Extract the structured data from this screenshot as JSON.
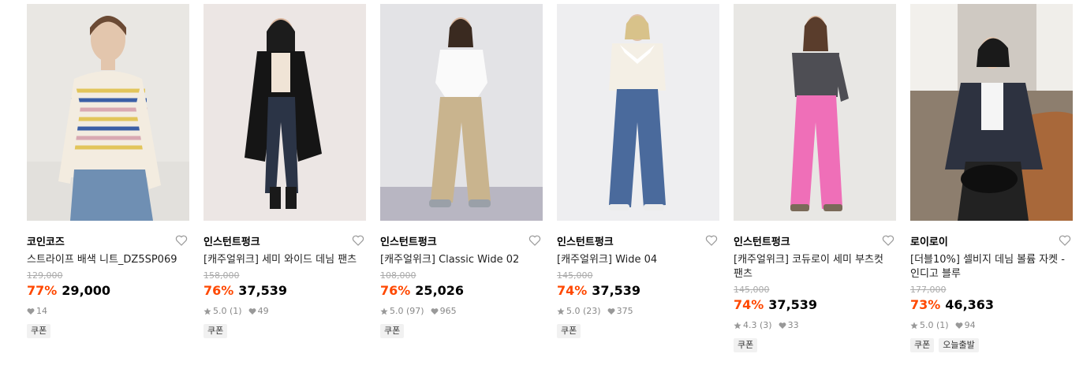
{
  "products": [
    {
      "brand": "코인코즈",
      "title": "스트라이프 배색 니트_DZ5SP069",
      "original_price": "129,000",
      "discount": "77%",
      "price": "29,000",
      "rating": "",
      "reviews": "",
      "likes": "14",
      "tags": [
        "쿠폰"
      ],
      "image": "woman-striped-knit"
    },
    {
      "brand": "인스턴트펑크",
      "title": "[캐주얼위크] 세미 와이드 데님 팬츠",
      "original_price": "158,000",
      "discount": "76%",
      "price": "37,539",
      "rating": "5.0",
      "reviews": "(1)",
      "likes": "49",
      "tags": [
        "쿠폰"
      ],
      "image": "woman-black-coat-denim"
    },
    {
      "brand": "인스턴트펑크",
      "title": "[캐주얼위크] Classic Wide 02",
      "original_price": "108,000",
      "discount": "76%",
      "price": "25,026",
      "rating": "5.0",
      "reviews": "(97)",
      "likes": "965",
      "tags": [
        "쿠폰"
      ],
      "image": "woman-beige-wide-pants"
    },
    {
      "brand": "인스턴트펑크",
      "title": "[캐주얼위크] Wide 04",
      "original_price": "145,000",
      "discount": "74%",
      "price": "37,539",
      "rating": "5.0",
      "reviews": "(23)",
      "likes": "375",
      "tags": [
        "쿠폰"
      ],
      "image": "woman-blue-wide-jeans"
    },
    {
      "brand": "인스턴트펑크",
      "title": "[캐주얼위크] 코듀로이 세미 부츠컷 팬츠",
      "original_price": "145,000",
      "discount": "74%",
      "price": "37,539",
      "rating": "4.3",
      "reviews": "(3)",
      "likes": "33",
      "tags": [
        "쿠폰"
      ],
      "image": "woman-pink-corduroy-pants"
    },
    {
      "brand": "로이로이",
      "title": "[더블10%] 셀비지 데님 볼륨 자켓 - 인디고 블루",
      "original_price": "177,000",
      "discount": "73%",
      "price": "46,363",
      "rating": "5.0",
      "reviews": "(1)",
      "likes": "94",
      "tags": [
        "쿠폰",
        "오늘출발"
      ],
      "image": "woman-denim-jacket-sofa"
    }
  ],
  "colors": {
    "discount": "#ff4800",
    "original_price": "#aaaaaa",
    "meta": "#888888",
    "tag_bg": "#f1f1f1"
  },
  "icons": {
    "like": "heart-outline-icon",
    "rating": "star-icon",
    "likes": "heart-filled-icon"
  }
}
